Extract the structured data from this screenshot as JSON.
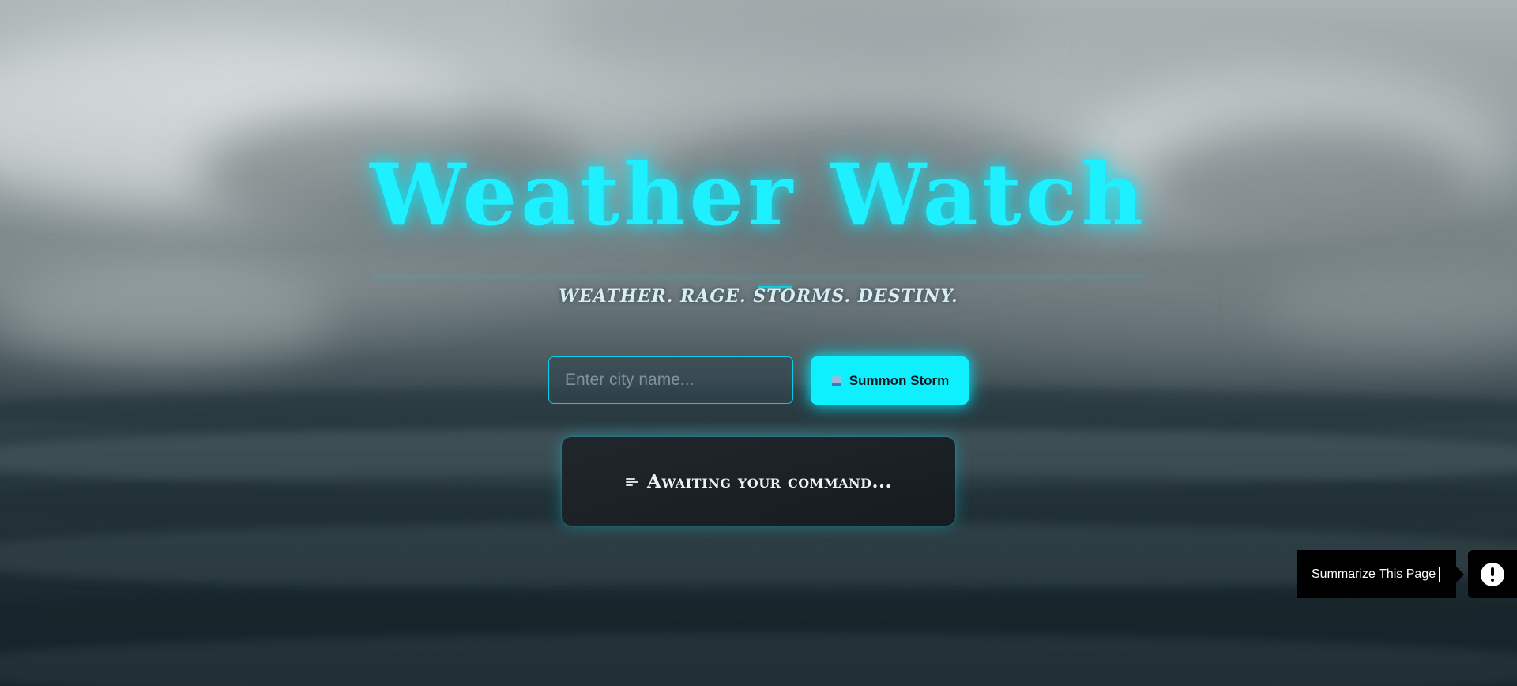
{
  "header": {
    "title": "Weather Watch",
    "tagline": "WEATHER. RAGE. STORMS. DESTINY."
  },
  "search": {
    "placeholder": "Enter city name...",
    "value": "",
    "button_label": "Summon Storm",
    "button_icon": "cloud-lightning-icon"
  },
  "status": {
    "icon": "wind-icon",
    "message": "Awaiting your command..."
  },
  "widget": {
    "summarize_label": "Summarize This Page",
    "chat_icon": "chat-bubble-alert-icon"
  },
  "colors": {
    "accent": "#0ff0ff",
    "card_bg": "#1e2428",
    "widget_bg": "#000000"
  }
}
